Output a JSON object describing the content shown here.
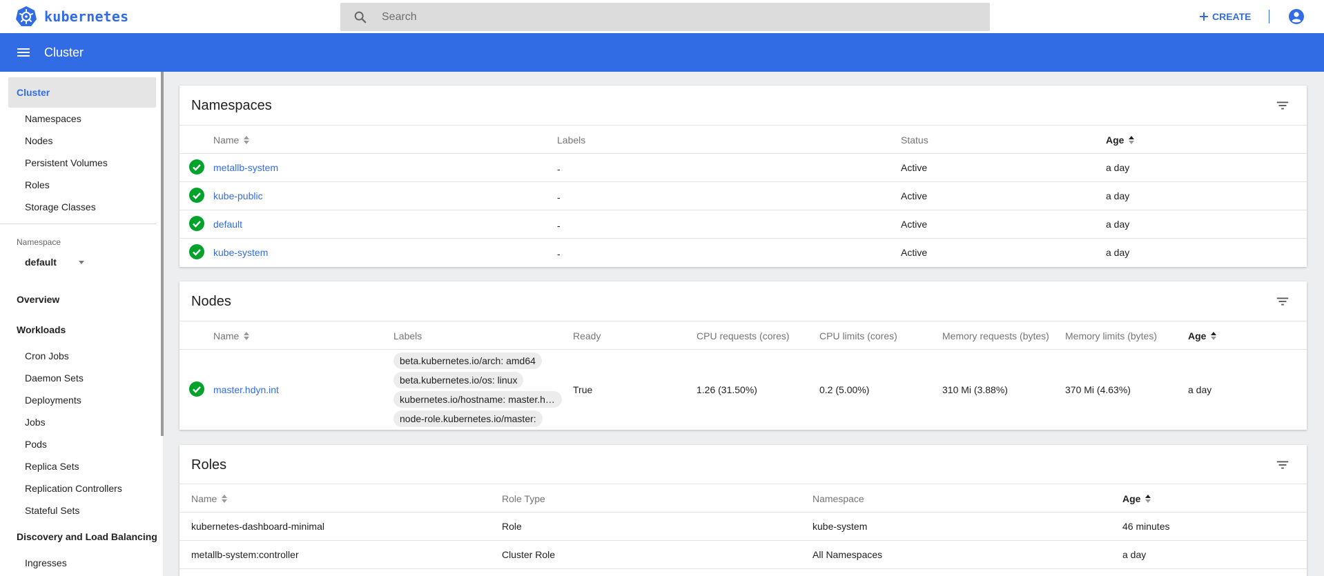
{
  "topbar": {
    "brand": "kubernetes",
    "search_placeholder": "Search",
    "create_label": "CREATE"
  },
  "header": {
    "title": "Cluster"
  },
  "sidebar": {
    "cluster_label": "Cluster",
    "cluster_items": [
      "Namespaces",
      "Nodes",
      "Persistent Volumes",
      "Roles",
      "Storage Classes"
    ],
    "namespace_label": "Namespace",
    "namespace_value": "default",
    "overview": "Overview",
    "workloads": "Workloads",
    "workload_items": [
      "Cron Jobs",
      "Daemon Sets",
      "Deployments",
      "Jobs",
      "Pods",
      "Replica Sets",
      "Replication Controllers",
      "Stateful Sets"
    ],
    "discovery": "Discovery and Load Balancing",
    "discovery_items": [
      "Ingresses"
    ]
  },
  "namespaces": {
    "title": "Namespaces",
    "columns": [
      "Name",
      "Labels",
      "Status",
      "Age"
    ],
    "rows": [
      {
        "name": "metallb-system",
        "labels": "-",
        "status": "Active",
        "age": "a day"
      },
      {
        "name": "kube-public",
        "labels": "-",
        "status": "Active",
        "age": "a day"
      },
      {
        "name": "default",
        "labels": "-",
        "status": "Active",
        "age": "a day"
      },
      {
        "name": "kube-system",
        "labels": "-",
        "status": "Active",
        "age": "a day"
      }
    ]
  },
  "nodes": {
    "title": "Nodes",
    "columns": [
      "Name",
      "Labels",
      "Ready",
      "CPU requests (cores)",
      "CPU limits (cores)",
      "Memory requests (bytes)",
      "Memory limits (bytes)",
      "Age"
    ],
    "rows": [
      {
        "name": "master.hdyn.int",
        "labels": [
          "beta.kubernetes.io/arch: amd64",
          "beta.kubernetes.io/os: linux",
          "kubernetes.io/hostname: master.hdyn.int",
          "node-role.kubernetes.io/master:"
        ],
        "ready": "True",
        "cpu_requests": "1.26 (31.50%)",
        "cpu_limits": "0.2 (5.00%)",
        "mem_requests": "310 Mi (3.88%)",
        "mem_limits": "370 Mi (4.63%)",
        "age": "a day"
      }
    ]
  },
  "roles": {
    "title": "Roles",
    "columns": [
      "Name",
      "Role Type",
      "Namespace",
      "Age"
    ],
    "rows": [
      {
        "name": "kubernetes-dashboard-minimal",
        "type": "Role",
        "namespace": "kube-system",
        "age": "46 minutes"
      },
      {
        "name": "metallb-system:controller",
        "type": "Cluster Role",
        "namespace": "All Namespaces",
        "age": "a day"
      }
    ]
  },
  "colors": {
    "brand_blue": "#326ce5",
    "success_green": "#00a32a",
    "background": "#edeef0"
  }
}
